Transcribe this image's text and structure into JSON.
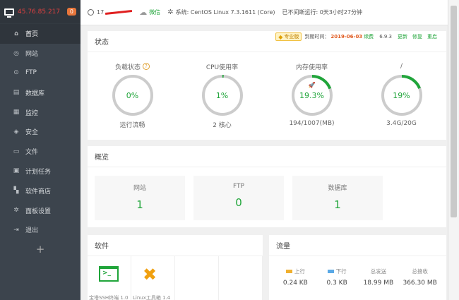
{
  "sidebar": {
    "ip": "45.76.85.217",
    "badge": "0",
    "items": [
      {
        "label": "首页",
        "icon": "home-icon",
        "glyph": "⌂",
        "active": true
      },
      {
        "label": "网站",
        "icon": "globe-icon",
        "glyph": "◎"
      },
      {
        "label": "FTP",
        "icon": "user-icon",
        "glyph": "⊙"
      },
      {
        "label": "数据库",
        "icon": "database-icon",
        "glyph": "▤"
      },
      {
        "label": "监控",
        "icon": "monitor-icon",
        "glyph": "▦"
      },
      {
        "label": "安全",
        "icon": "shield-icon",
        "glyph": "◈"
      },
      {
        "label": "文件",
        "icon": "folder-icon",
        "glyph": "▭"
      },
      {
        "label": "计划任务",
        "icon": "calendar-icon",
        "glyph": "▣"
      },
      {
        "label": "软件商店",
        "icon": "grid-icon",
        "glyph": "▚"
      },
      {
        "label": "面板设置",
        "icon": "settings-icon",
        "glyph": "✲"
      },
      {
        "label": "退出",
        "icon": "logout-icon",
        "glyph": "⇥"
      }
    ],
    "add_label": "+"
  },
  "topbar": {
    "user": "17",
    "wechat": "微信",
    "system_label": "系统:",
    "system": "CentOS Linux 7.3.1611 (Core)",
    "uptime": "已不间断运行: 0天3小时27分钟"
  },
  "status": {
    "title": "状态",
    "pro_label": "专业版",
    "expire_label": "到期时间：",
    "expire_date": "2019-06-03",
    "renew": "续费",
    "version": "6.9.3",
    "update": "更新",
    "repair": "修复",
    "restart": "重启",
    "gauges": [
      {
        "title": "负载状态",
        "value": "0%",
        "percent": 0,
        "sub": "运行流畅",
        "help": "?"
      },
      {
        "title": "CPU使用率",
        "value": "1%",
        "percent": 1,
        "sub": "2 核心"
      },
      {
        "title": "内存使用率",
        "value": "19.3%",
        "percent": 19.3,
        "sub": "194/1007(MB)",
        "leaf": "🚀"
      },
      {
        "title": "/",
        "value": "19%",
        "percent": 19,
        "sub": "3.4G/20G"
      }
    ]
  },
  "overview": {
    "title": "概览",
    "boxes": [
      {
        "label": "网站",
        "value": "1"
      },
      {
        "label": "FTP",
        "value": "0"
      },
      {
        "label": "数据库",
        "value": "1"
      }
    ]
  },
  "software": {
    "title": "软件",
    "items": [
      {
        "icon": "terminal-icon",
        "caption": "宝塔SSH终端 1.0"
      },
      {
        "icon": "tools-icon",
        "caption": "Linux工具箱 1.4"
      }
    ]
  },
  "traffic": {
    "title": "流量",
    "cols": [
      {
        "label": "上行",
        "value": "0.24 KB",
        "color": "#f0b030"
      },
      {
        "label": "下行",
        "value": "0.3 KB",
        "color": "#5aa9e6"
      },
      {
        "label": "总发送",
        "value": "18.99 MB"
      },
      {
        "label": "总接收",
        "value": "366.30 MB"
      }
    ]
  },
  "colors": {
    "accent": "#20a53a",
    "track": "#cccccc"
  }
}
